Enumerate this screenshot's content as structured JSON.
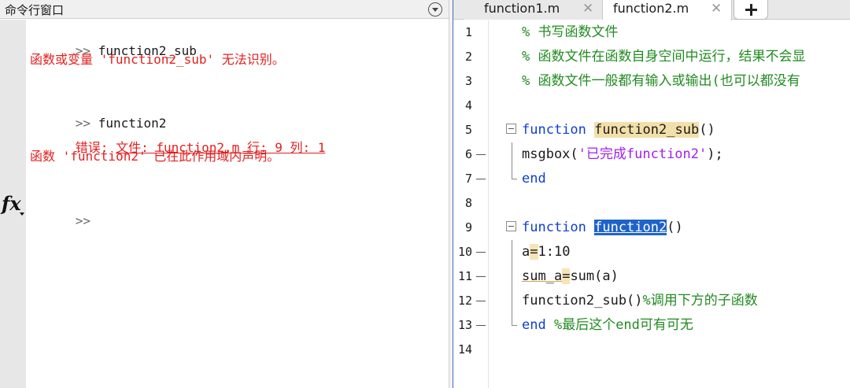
{
  "command_window": {
    "title": "命令行窗口",
    "lines": [
      {
        "prompt": ">>",
        "text": "function2_sub"
      },
      {
        "error": "函数或变量 'function2_sub' 无法识别。"
      },
      {
        "prompt": ">>",
        "text": "function2"
      },
      {
        "error_prefix": "错误: ",
        "error_link": "文件: function2.m 行: 9 列: 1"
      },
      {
        "error": "函数 'function2' 已在此作用域内声明。"
      }
    ],
    "current_prompt": ">>",
    "fx_label": "fx"
  },
  "editor": {
    "tabs": [
      {
        "label": "function1.m",
        "close": "✕",
        "active": false
      },
      {
        "label": "function2.m",
        "close": "✕",
        "active": true
      }
    ],
    "add_tab": "+",
    "lines": [
      {
        "num": "1",
        "comment": "% 书写函数文件"
      },
      {
        "num": "2",
        "comment": "% 函数文件在函数自身空间中运行，结果不会显"
      },
      {
        "num": "3",
        "comment": "% 函数文件一般都有输入或输出(也可以都没有"
      },
      {
        "num": "4"
      },
      {
        "num": "5",
        "kw": "function",
        "name": "function2_sub",
        "rest": "()"
      },
      {
        "num": "6",
        "pre": "msgbox(",
        "str": "'已完成function2'",
        "post": ");"
      },
      {
        "num": "7",
        "kw": "end"
      },
      {
        "num": "8"
      },
      {
        "num": "9",
        "kw": "function",
        "name": "function2",
        "rest": "()"
      },
      {
        "num": "10",
        "var": "a",
        "eq": "=",
        "post": "1:10"
      },
      {
        "num": "11",
        "var": "sum_a",
        "eq": "=",
        "post": "sum(a)"
      },
      {
        "num": "12",
        "pre": "function2_sub()",
        "comment": "%调用下方的子函数"
      },
      {
        "num": "13",
        "kw": "end",
        "comment": " %最后这个end可有可无"
      },
      {
        "num": "14"
      }
    ]
  }
}
